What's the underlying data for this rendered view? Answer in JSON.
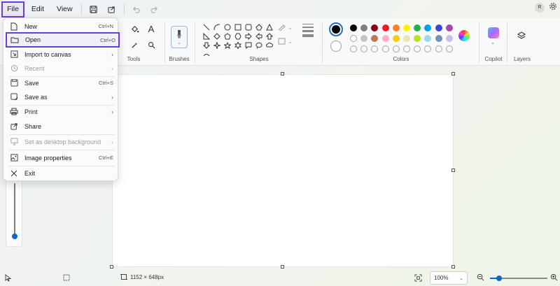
{
  "menubar": {
    "file": "File",
    "edit": "Edit",
    "view": "View",
    "account_initial": "R"
  },
  "ribbon": {
    "tools_label": "Tools",
    "brushes_label": "Brushes",
    "shapes_label": "Shapes",
    "colors_label": "Colors",
    "copilot_label": "Copilot",
    "layers_label": "Layers",
    "palette": [
      "#000000",
      "#7f7f7f",
      "#880015",
      "#ed1c24",
      "#ff7f27",
      "#fff200",
      "#22b14c",
      "#00a2e8",
      "#3f48cc",
      "#a349a4",
      "#ffffff",
      "#c3c3c3",
      "#b97a57",
      "#ffaec9",
      "#ffc90e",
      "#efe4b0",
      "#b5e61d",
      "#99d9ea",
      "#7092be",
      "#c8bfe7",
      "",
      "",
      "",
      "",
      "",
      "",
      "",
      "",
      "",
      ""
    ],
    "primary_color": "#000000"
  },
  "file_menu": {
    "items": [
      {
        "label": "New",
        "shortcut": "Ctrl+N",
        "icon": "new-file-icon"
      },
      {
        "label": "Open",
        "shortcut": "Ctrl+O",
        "icon": "folder-icon"
      },
      {
        "label": "Import to canvas",
        "shortcut": "",
        "icon": "import-icon"
      },
      {
        "label": "Recent",
        "shortcut": "",
        "icon": "clock-icon"
      },
      {
        "label": "Save",
        "shortcut": "Ctrl+S",
        "icon": "save-icon"
      },
      {
        "label": "Save as",
        "shortcut": "",
        "icon": "save-as-icon"
      },
      {
        "label": "Print",
        "shortcut": "",
        "icon": "print-icon"
      },
      {
        "label": "Share",
        "shortcut": "",
        "icon": "share-icon"
      },
      {
        "label": "Set as desktop background",
        "shortcut": "",
        "icon": "desktop-icon"
      },
      {
        "label": "Image properties",
        "shortcut": "Ctrl+E",
        "icon": "image-properties-icon"
      },
      {
        "label": "Exit",
        "shortcut": "",
        "icon": "close-icon"
      }
    ]
  },
  "status": {
    "canvas_size": "1152 × 648px",
    "zoom": "100%",
    "zoom_level": 0.16
  },
  "colors": {
    "accent": "#6a3fd0",
    "blue": "#0e67c1"
  }
}
